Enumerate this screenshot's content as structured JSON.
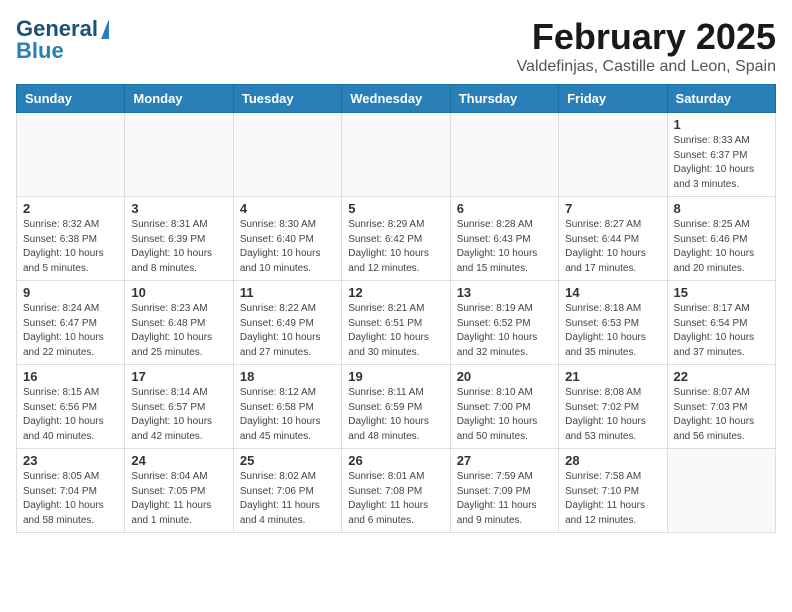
{
  "header": {
    "logo_general": "General",
    "logo_blue": "Blue",
    "month": "February 2025",
    "location": "Valdefinjas, Castille and Leon, Spain"
  },
  "weekdays": [
    "Sunday",
    "Monday",
    "Tuesday",
    "Wednesday",
    "Thursday",
    "Friday",
    "Saturday"
  ],
  "weeks": [
    [
      {
        "day": "",
        "info": ""
      },
      {
        "day": "",
        "info": ""
      },
      {
        "day": "",
        "info": ""
      },
      {
        "day": "",
        "info": ""
      },
      {
        "day": "",
        "info": ""
      },
      {
        "day": "",
        "info": ""
      },
      {
        "day": "1",
        "info": "Sunrise: 8:33 AM\nSunset: 6:37 PM\nDaylight: 10 hours\nand 3 minutes."
      }
    ],
    [
      {
        "day": "2",
        "info": "Sunrise: 8:32 AM\nSunset: 6:38 PM\nDaylight: 10 hours\nand 5 minutes."
      },
      {
        "day": "3",
        "info": "Sunrise: 8:31 AM\nSunset: 6:39 PM\nDaylight: 10 hours\nand 8 minutes."
      },
      {
        "day": "4",
        "info": "Sunrise: 8:30 AM\nSunset: 6:40 PM\nDaylight: 10 hours\nand 10 minutes."
      },
      {
        "day": "5",
        "info": "Sunrise: 8:29 AM\nSunset: 6:42 PM\nDaylight: 10 hours\nand 12 minutes."
      },
      {
        "day": "6",
        "info": "Sunrise: 8:28 AM\nSunset: 6:43 PM\nDaylight: 10 hours\nand 15 minutes."
      },
      {
        "day": "7",
        "info": "Sunrise: 8:27 AM\nSunset: 6:44 PM\nDaylight: 10 hours\nand 17 minutes."
      },
      {
        "day": "8",
        "info": "Sunrise: 8:25 AM\nSunset: 6:46 PM\nDaylight: 10 hours\nand 20 minutes."
      }
    ],
    [
      {
        "day": "9",
        "info": "Sunrise: 8:24 AM\nSunset: 6:47 PM\nDaylight: 10 hours\nand 22 minutes."
      },
      {
        "day": "10",
        "info": "Sunrise: 8:23 AM\nSunset: 6:48 PM\nDaylight: 10 hours\nand 25 minutes."
      },
      {
        "day": "11",
        "info": "Sunrise: 8:22 AM\nSunset: 6:49 PM\nDaylight: 10 hours\nand 27 minutes."
      },
      {
        "day": "12",
        "info": "Sunrise: 8:21 AM\nSunset: 6:51 PM\nDaylight: 10 hours\nand 30 minutes."
      },
      {
        "day": "13",
        "info": "Sunrise: 8:19 AM\nSunset: 6:52 PM\nDaylight: 10 hours\nand 32 minutes."
      },
      {
        "day": "14",
        "info": "Sunrise: 8:18 AM\nSunset: 6:53 PM\nDaylight: 10 hours\nand 35 minutes."
      },
      {
        "day": "15",
        "info": "Sunrise: 8:17 AM\nSunset: 6:54 PM\nDaylight: 10 hours\nand 37 minutes."
      }
    ],
    [
      {
        "day": "16",
        "info": "Sunrise: 8:15 AM\nSunset: 6:56 PM\nDaylight: 10 hours\nand 40 minutes."
      },
      {
        "day": "17",
        "info": "Sunrise: 8:14 AM\nSunset: 6:57 PM\nDaylight: 10 hours\nand 42 minutes."
      },
      {
        "day": "18",
        "info": "Sunrise: 8:12 AM\nSunset: 6:58 PM\nDaylight: 10 hours\nand 45 minutes."
      },
      {
        "day": "19",
        "info": "Sunrise: 8:11 AM\nSunset: 6:59 PM\nDaylight: 10 hours\nand 48 minutes."
      },
      {
        "day": "20",
        "info": "Sunrise: 8:10 AM\nSunset: 7:00 PM\nDaylight: 10 hours\nand 50 minutes."
      },
      {
        "day": "21",
        "info": "Sunrise: 8:08 AM\nSunset: 7:02 PM\nDaylight: 10 hours\nand 53 minutes."
      },
      {
        "day": "22",
        "info": "Sunrise: 8:07 AM\nSunset: 7:03 PM\nDaylight: 10 hours\nand 56 minutes."
      }
    ],
    [
      {
        "day": "23",
        "info": "Sunrise: 8:05 AM\nSunset: 7:04 PM\nDaylight: 10 hours\nand 58 minutes."
      },
      {
        "day": "24",
        "info": "Sunrise: 8:04 AM\nSunset: 7:05 PM\nDaylight: 11 hours\nand 1 minute."
      },
      {
        "day": "25",
        "info": "Sunrise: 8:02 AM\nSunset: 7:06 PM\nDaylight: 11 hours\nand 4 minutes."
      },
      {
        "day": "26",
        "info": "Sunrise: 8:01 AM\nSunset: 7:08 PM\nDaylight: 11 hours\nand 6 minutes."
      },
      {
        "day": "27",
        "info": "Sunrise: 7:59 AM\nSunset: 7:09 PM\nDaylight: 11 hours\nand 9 minutes."
      },
      {
        "day": "28",
        "info": "Sunrise: 7:58 AM\nSunset: 7:10 PM\nDaylight: 11 hours\nand 12 minutes."
      },
      {
        "day": "",
        "info": ""
      }
    ]
  ]
}
